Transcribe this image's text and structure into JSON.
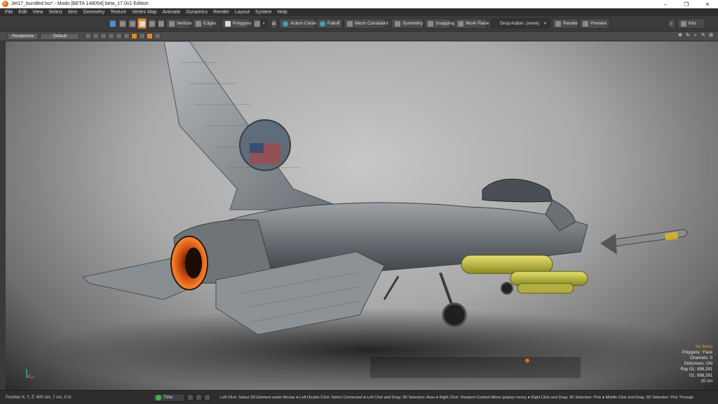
{
  "window": {
    "title": "Jet17_bundled.lxo* - Modo [BETA 148054]  beta_17.0v1 Edition",
    "controls": {
      "minimize": "–",
      "maximize": "❐",
      "close": "✕"
    }
  },
  "menu": [
    "File",
    "Edit",
    "View",
    "Select",
    "Item",
    "Geometry",
    "Texture",
    "Vertex Map",
    "Animate",
    "Dynamics",
    "Render",
    "Layout",
    "System",
    "Help"
  ],
  "toolbar": {
    "vertices": "Vertices",
    "edges": "Edges",
    "polygons": "Polygons",
    "action_center": "Action Center",
    "falloff": "Falloff",
    "mesh_constraint": "Mesh Constraint",
    "symmetry": "Symmetry",
    "snapping": "Snapping",
    "work_plane": "Work Plane",
    "drop_action": "Drop Action: (none)",
    "render": "Render",
    "preview": "Preview",
    "kits": "Kits"
  },
  "viewport": {
    "view_type": "Perspective",
    "shading": "Default",
    "info": {
      "no_items": "No Items",
      "polygons": "Polygons : Face",
      "channels": "Channels: 0",
      "deformers": "Deformers: ON",
      "ray_gl": "Ray GL: 898,281",
      "gl": "GL: 898,281",
      "scale": "20 cm"
    }
  },
  "status": {
    "position": "Position X, Y, Z:   400 um,  7 cm, 0 m",
    "time": "Time",
    "hints": "Left Click: Select 3D Element under Mouse ● Left Double Click: Select Connected ● Left Click and Drag: 3D Selection: Area ● Right Click: Viewport Context Menu (popup menu) ● Right Click and Drag: 3D Selection: Pick ● Middle Click and Drag: 3D Selection: Pick Through"
  },
  "colors": {
    "accent": "#e08a24",
    "menubar": "#2f2f2f",
    "toolbar": "#3c3c3c"
  }
}
